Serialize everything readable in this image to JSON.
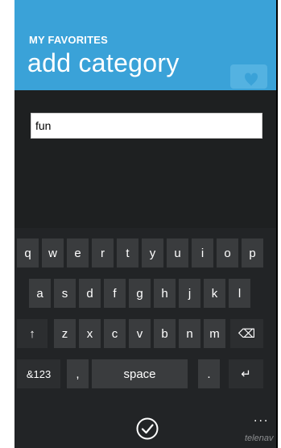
{
  "app_title": "MY FAVORITES",
  "page_title": "add category",
  "input": {
    "value": "fun"
  },
  "keyboard": {
    "row1": [
      "q",
      "w",
      "e",
      "r",
      "t",
      "y",
      "u",
      "i",
      "o",
      "p"
    ],
    "row2": [
      "a",
      "s",
      "d",
      "f",
      "g",
      "h",
      "j",
      "k",
      "l"
    ],
    "row3": [
      "↑",
      "z",
      "x",
      "c",
      "v",
      "b",
      "n",
      "m",
      "⌫"
    ],
    "row4": [
      "&123",
      ",",
      "space",
      ".",
      "↵"
    ]
  },
  "footer": {
    "more": "...",
    "brand": "telenav"
  },
  "colors": {
    "header": "#3aa2d8",
    "background": "#1e2021",
    "key": "#3a3c3e"
  }
}
